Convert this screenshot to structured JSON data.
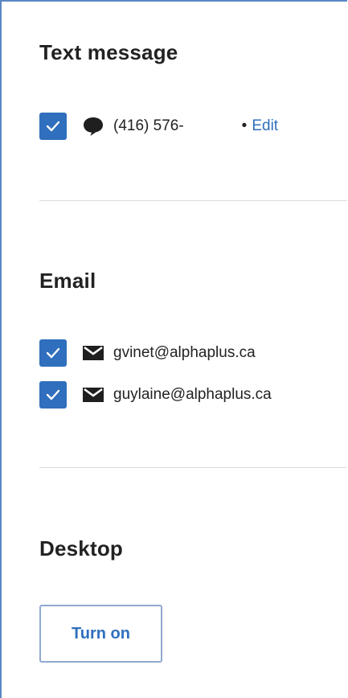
{
  "sections": {
    "text_message": {
      "title": "Text message",
      "phone": "(416) 576-",
      "bullet": "•",
      "edit_label": "Edit",
      "checked": true
    },
    "email": {
      "title": "Email",
      "items": [
        {
          "address": "gvinet@alphaplus.ca",
          "checked": true
        },
        {
          "address": "guylaine@alphaplus.ca",
          "checked": true
        }
      ]
    },
    "desktop": {
      "title": "Desktop",
      "button_label": "Turn on"
    }
  },
  "colors": {
    "accent": "#2f6fbd",
    "text": "#222222",
    "divider": "#dcdcdc",
    "panel_border": "#5b86c5"
  },
  "icons": {
    "checkbox_check": "check-icon",
    "sms": "chat-bubble-icon",
    "email": "envelope-icon"
  }
}
